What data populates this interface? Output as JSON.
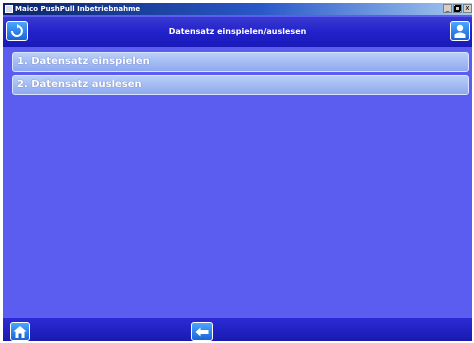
{
  "window": {
    "title": "Maico PushPull Inbetriebnahme",
    "controls": [
      "_",
      " ",
      "x"
    ]
  },
  "header": {
    "title": "Datensatz einspielen/auslesen",
    "left_icon": "refresh-icon",
    "right_icon": "user-icon"
  },
  "menu": {
    "items": [
      {
        "label": "1. Datensatz einspielen"
      },
      {
        "label": "2. Datensatz auslesen"
      }
    ]
  },
  "footer": {
    "home_icon": "home-icon",
    "back_icon": "back-arrow-icon"
  },
  "colors": {
    "background": "#5B5CF0",
    "header": "#2222CC",
    "button": "#1A7AF0",
    "menu_item": "#A6BEF5"
  }
}
